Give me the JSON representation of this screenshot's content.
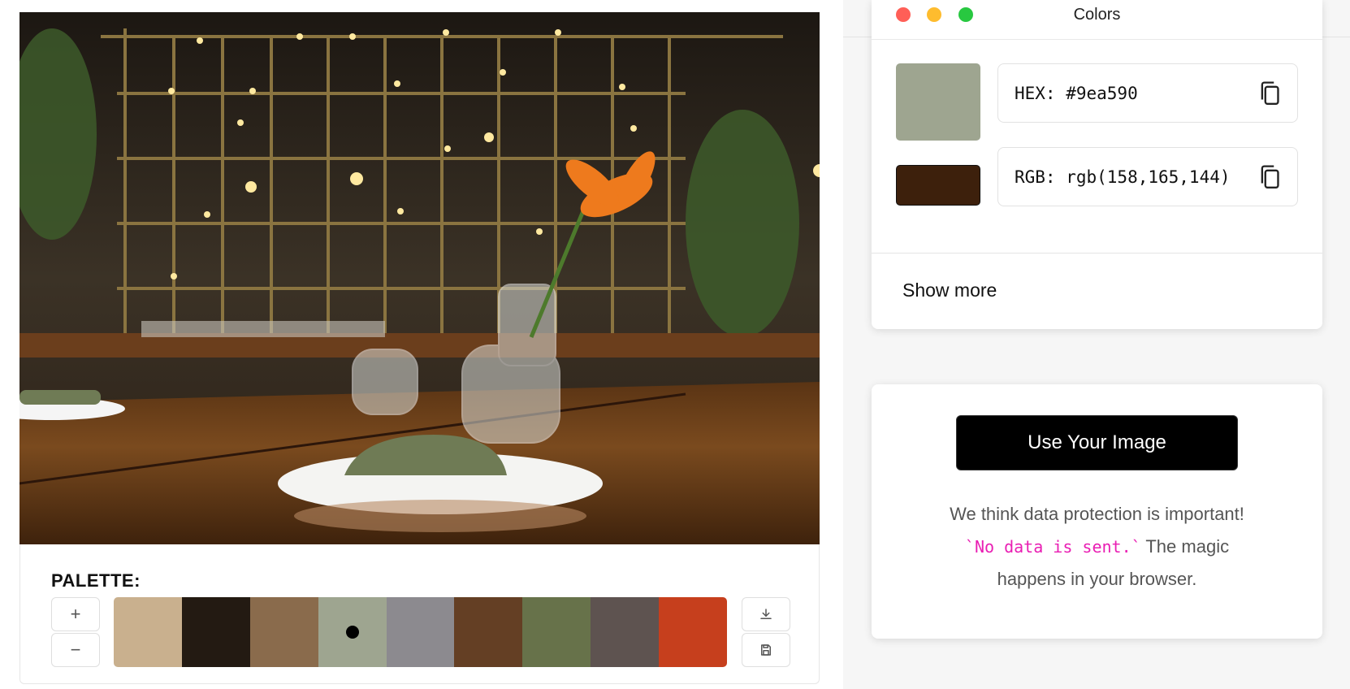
{
  "image_panel": {
    "photo_alt": "restaurant-table-photo"
  },
  "palette": {
    "title": "PALETTE:",
    "add_label": "+",
    "remove_label": "−",
    "selected_index": 3,
    "swatches": [
      "#c9b08e",
      "#231a12",
      "#8a6b4c",
      "#9ea590",
      "#8c8a8f",
      "#643f24",
      "#67724a",
      "#5e5350",
      "#c63f1d"
    ]
  },
  "colors_window": {
    "title": "Colors",
    "traffic_lights": [
      "#ff5f57",
      "#febc2e",
      "#28c840"
    ],
    "primary_swatch": "#9ea590",
    "secondary_swatch": "#3d200c",
    "hex_value": "HEX: #9ea590",
    "rgb_value": "RGB: rgb(158,165,144)",
    "show_more": "Show more"
  },
  "info": {
    "button_label": "Use Your Image",
    "line1": "We think data protection is important!",
    "code": "`No data is sent.`",
    "line2_rest": " The magic",
    "line3": "happens in your browser."
  }
}
